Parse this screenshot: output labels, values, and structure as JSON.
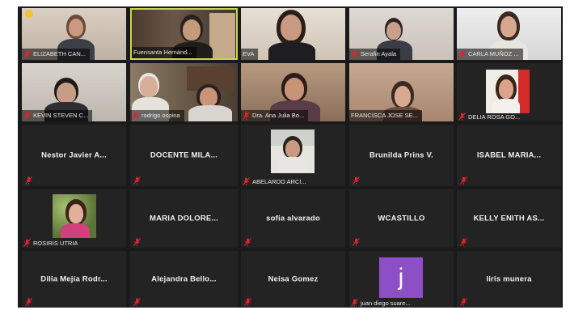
{
  "participants": [
    {
      "name": "ELIZABETH CAN...",
      "muted": true,
      "type": "video",
      "raised_hand": true
    },
    {
      "name": "Fuensanta Hernánd...",
      "muted": false,
      "type": "video",
      "speaking": true
    },
    {
      "name": "EVA",
      "muted": false,
      "type": "video"
    },
    {
      "name": "Serafin Ayala",
      "muted": true,
      "type": "video"
    },
    {
      "name": "CARLA MUÑOZ ...",
      "muted": true,
      "type": "video"
    },
    {
      "name": "KEVIN STEVEN C...",
      "muted": true,
      "type": "video"
    },
    {
      "name": "rodrigo ospina",
      "muted": true,
      "type": "video"
    },
    {
      "name": "Dra. Ana Julia Bo...",
      "muted": true,
      "type": "video"
    },
    {
      "name": "FRANCISCA JOSE SE...",
      "muted": false,
      "type": "video"
    },
    {
      "name": "DELIA ROSA GO...",
      "muted": true,
      "type": "photo"
    },
    {
      "name": "Nestor Javier A...",
      "muted": true,
      "type": "name"
    },
    {
      "name": "DOCENTE MILA...",
      "muted": true,
      "type": "name"
    },
    {
      "name": "ABELARDO ARCI...",
      "muted": true,
      "type": "photo"
    },
    {
      "name": "Brunilda Prins V.",
      "muted": true,
      "type": "name"
    },
    {
      "name": "ISABEL MARIA...",
      "muted": true,
      "type": "name"
    },
    {
      "name": "ROSIRIS UTRIA",
      "muted": true,
      "type": "photo"
    },
    {
      "name": "MARIA DOLORE...",
      "muted": true,
      "type": "name"
    },
    {
      "name": "sofia alvarado",
      "muted": true,
      "type": "name"
    },
    {
      "name": "WCASTILLO",
      "muted": true,
      "type": "name"
    },
    {
      "name": "KELLY ENITH AS...",
      "muted": true,
      "type": "name"
    },
    {
      "name": "Dilia  Mejía  Rodr...",
      "muted": true,
      "type": "name"
    },
    {
      "name": "Alejandra  Bello...",
      "muted": true,
      "type": "name"
    },
    {
      "name": "Neisa Gomez",
      "muted": true,
      "type": "name"
    },
    {
      "name": "juan diego suare...",
      "muted": true,
      "type": "avatar",
      "initial": "j"
    },
    {
      "name": "liris munera",
      "muted": true,
      "type": "name"
    }
  ],
  "colors": {
    "mute_icon": "#e0232e",
    "active_speaker_border": "#c8d64a",
    "avatar_bg": "#8c4fc6",
    "tile_bg": "#232323"
  }
}
